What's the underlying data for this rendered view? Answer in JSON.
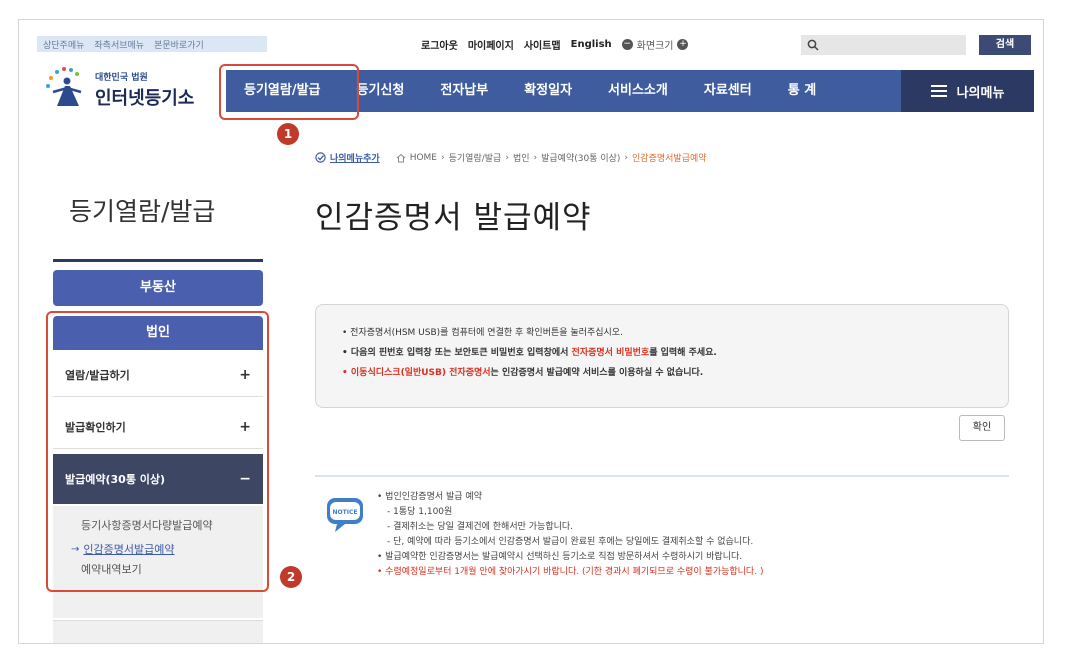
{
  "utility": {
    "skip_links": [
      "상단주메뉴",
      "좌측서브메뉴",
      "본문바로가기"
    ],
    "logout": "로그아웃",
    "mypage": "마이페이지",
    "sitemap": "사이트맵",
    "english": "English",
    "font_size_label": "화면크기",
    "font_minus": "−",
    "font_plus": "+",
    "search_placeholder": "",
    "search_button": "검색"
  },
  "logo": {
    "sub": "대한민국 법원",
    "main": "인터넷등기소"
  },
  "gnb": {
    "items": [
      "등기열람/발급",
      "등기신청",
      "전자납부",
      "확정일자",
      "서비스소개",
      "자료센터",
      "통 계"
    ],
    "my_menu": "나의메뉴"
  },
  "badges": [
    "1",
    "2"
  ],
  "breadcrumb": {
    "add": "나의메뉴추가",
    "path": [
      "HOME",
      "등기열람/발급",
      "법인",
      "발급예약(30통 이상)"
    ],
    "current": "인감증명서발급예약"
  },
  "side_title": "등기열람/발급",
  "page_title": "인감증명서 발급예약",
  "lnb": {
    "tab_real_estate": "부동산",
    "tab_corporation": "법인",
    "rows": [
      {
        "label": "열람/발급하기",
        "sign": "+"
      },
      {
        "label": "발급확인하기",
        "sign": "+"
      },
      {
        "label": "발급예약(30통 이상)",
        "sign": "−"
      }
    ],
    "submenu": [
      "등기사항증명서다량발급예약",
      "인감증명서발급예약",
      "예약내역보기"
    ]
  },
  "notice_box": {
    "line1": "• 전자증명서(HSM USB)를 컴퓨터에 연결한 후 확인버튼을 눌러주십시오.",
    "line2_a": "• 다음의 핀번호 입력창 또는 보안토큰 비밀번호 입력창에서 ",
    "line2_red": "전자증명서 비밀번호",
    "line2_b": "를 입력해 주세요.",
    "line3_red": "• 이동식디스크(일반USB) 전자증명서",
    "line3_b": "는 인감증명서 발급예약 서비스를 이용하실 수 없습니다.",
    "confirm_button": "확인"
  },
  "info": {
    "icon_label": "NOTICE",
    "lines": [
      "• 법인인감증명서 발급 예약",
      "- 1통당 1,100원",
      "- 결제취소는 당일 결제건에 한해서만 가능합니다.",
      "- 단, 예약에 따라 등기소에서 인감증명서 발급이 완료된 후에는 당일에도 결제취소할 수 없습니다.",
      "• 발급예약한 인감증명서는 발급예약시 선택하신 등기소로 직접 방문하셔서 수령하시기 바랍니다.",
      "• 수령예정일로부터 1개월 안에 찾아가시기 바랍니다. (기한 경과시 폐기되므로 수령이 불가능합니다. )"
    ]
  },
  "colors": {
    "gnb_blue": "#3f5d9e",
    "dark_navy": "#2c3a63",
    "highlight_red": "#d94a3a",
    "accent_red": "#d9301f"
  }
}
